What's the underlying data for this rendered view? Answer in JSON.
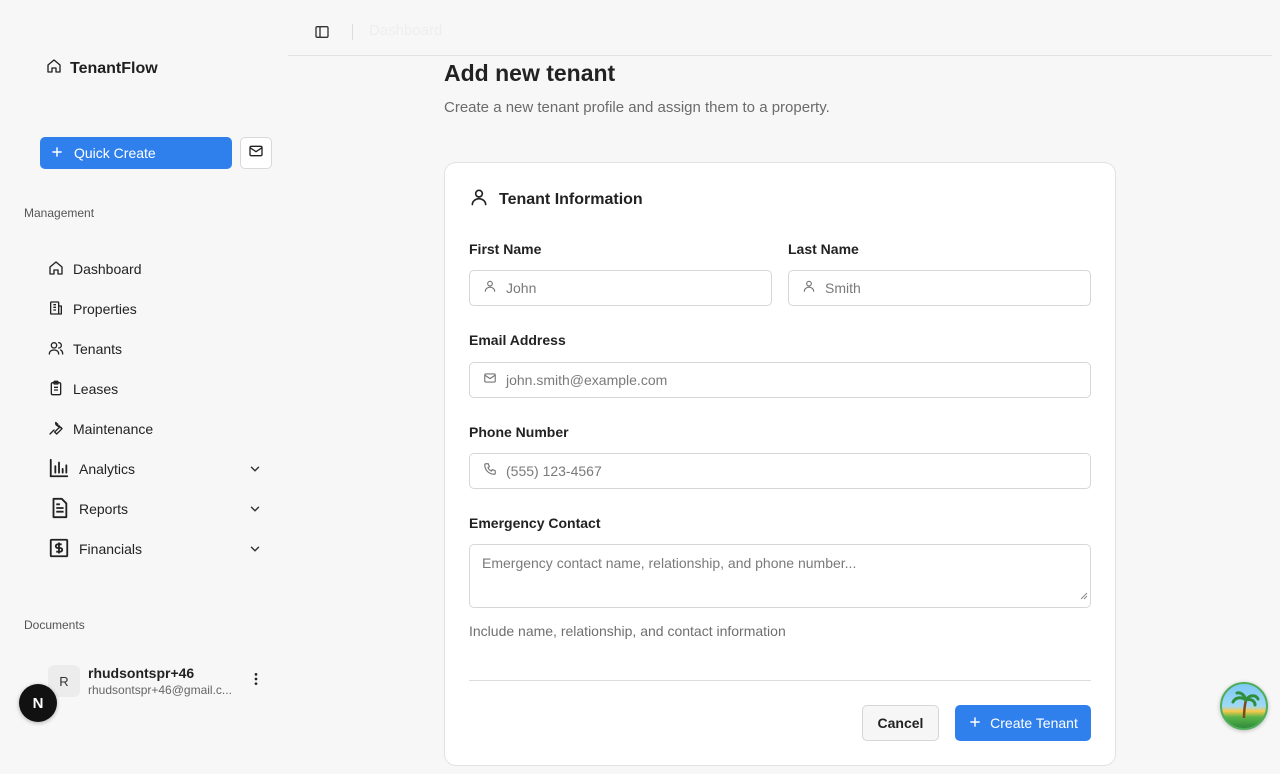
{
  "brand": {
    "name": "TenantFlow"
  },
  "sidebar": {
    "quick_create_label": "Quick Create",
    "management_label": "Management",
    "items": [
      {
        "label": "Dashboard",
        "icon": "home-icon"
      },
      {
        "label": "Properties",
        "icon": "building-icon"
      },
      {
        "label": "Tenants",
        "icon": "users-icon"
      },
      {
        "label": "Leases",
        "icon": "clipboard-icon"
      },
      {
        "label": "Maintenance",
        "icon": "wrench-icon"
      },
      {
        "label": "Analytics",
        "icon": "bar-chart-icon"
      },
      {
        "label": "Reports",
        "icon": "document-icon"
      },
      {
        "label": "Financials",
        "icon": "dollar-icon"
      }
    ],
    "documents_label": "Documents",
    "user": {
      "initial": "R",
      "name": "rhudsontspr+46",
      "email": "rhudsontspr+46@gmail.c..."
    }
  },
  "topbar": {
    "breadcrumb": "Dashboard"
  },
  "page": {
    "title": "Add new tenant",
    "subtitle": "Create a new tenant profile and assign them to a property."
  },
  "form": {
    "section_title": "Tenant Information",
    "first_name": {
      "label": "First Name",
      "placeholder": "John"
    },
    "last_name": {
      "label": "Last Name",
      "placeholder": "Smith"
    },
    "email": {
      "label": "Email Address",
      "placeholder": "john.smith@example.com"
    },
    "phone": {
      "label": "Phone Number",
      "placeholder": "(555) 123-4567"
    },
    "emergency": {
      "label": "Emergency Contact",
      "placeholder": "Emergency contact name, relationship, and phone number...",
      "hint": "Include name, relationship, and contact information"
    },
    "cancel_label": "Cancel",
    "submit_label": "Create Tenant"
  },
  "badge": {
    "next_label": "N"
  },
  "colors": {
    "primary": "#2f80ed",
    "background": "#f7f7f7",
    "card": "#ffffff"
  }
}
